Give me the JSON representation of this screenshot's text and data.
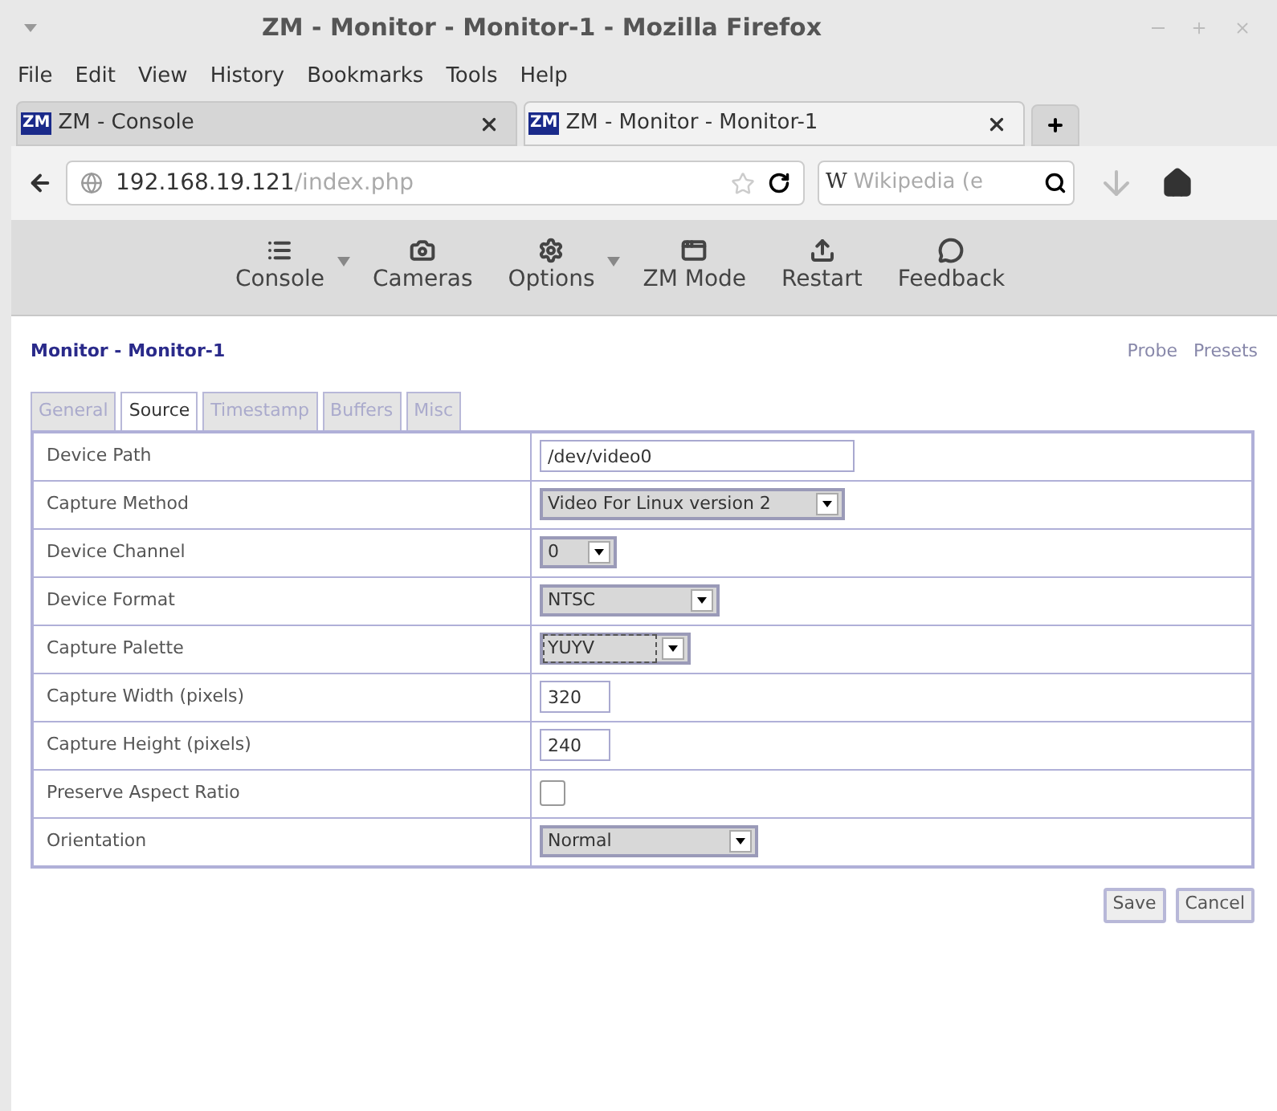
{
  "window": {
    "title": "ZM - Monitor - Monitor-1 - Mozilla Firefox"
  },
  "menu": [
    "File",
    "Edit",
    "View",
    "History",
    "Bookmarks",
    "Tools",
    "Help"
  ],
  "browser_tabs": [
    {
      "icon": "ZM",
      "label": "ZM - Console",
      "selected": false
    },
    {
      "icon": "ZM",
      "label": "ZM - Monitor - Monitor-1",
      "selected": true
    }
  ],
  "address": {
    "host": "192.168.19.121",
    "path": "/index.php"
  },
  "search": {
    "engine": "W",
    "placeholder": "Wikipedia (e"
  },
  "toolbar": [
    {
      "label": "Console",
      "dropdown": true
    },
    {
      "label": "Cameras",
      "dropdown": false
    },
    {
      "label": "Options",
      "dropdown": true
    },
    {
      "label": "ZM Mode",
      "dropdown": false
    },
    {
      "label": "Restart",
      "dropdown": false
    },
    {
      "label": "Feedback",
      "dropdown": false
    }
  ],
  "page": {
    "title": "Monitor - Monitor-1",
    "links": [
      "Probe",
      "Presets"
    ]
  },
  "tabs": [
    {
      "label": "General",
      "selected": false
    },
    {
      "label": "Source",
      "selected": true
    },
    {
      "label": "Timestamp",
      "selected": false
    },
    {
      "label": "Buffers",
      "selected": false
    },
    {
      "label": "Misc",
      "selected": false
    }
  ],
  "rows": [
    {
      "label": "Device Path",
      "kind": "text",
      "value": "/dev/video0"
    },
    {
      "label": "Capture Method",
      "kind": "select",
      "value": "Video For Linux version 2",
      "focused": false
    },
    {
      "label": "Device Channel",
      "kind": "select",
      "value": "0",
      "focused": false
    },
    {
      "label": "Device Format",
      "kind": "select",
      "value": "NTSC",
      "focused": false
    },
    {
      "label": "Capture Palette",
      "kind": "select",
      "value": "YUYV",
      "focused": true
    },
    {
      "label": "Capture Width (pixels)",
      "kind": "text",
      "value": "320"
    },
    {
      "label": "Capture Height (pixels)",
      "kind": "text",
      "value": "240"
    },
    {
      "label": "Preserve Aspect Ratio",
      "kind": "checkbox",
      "checked": false
    },
    {
      "label": "Orientation",
      "kind": "select",
      "value": "Normal",
      "focused": false
    }
  ],
  "buttons": [
    "Save",
    "Cancel"
  ]
}
